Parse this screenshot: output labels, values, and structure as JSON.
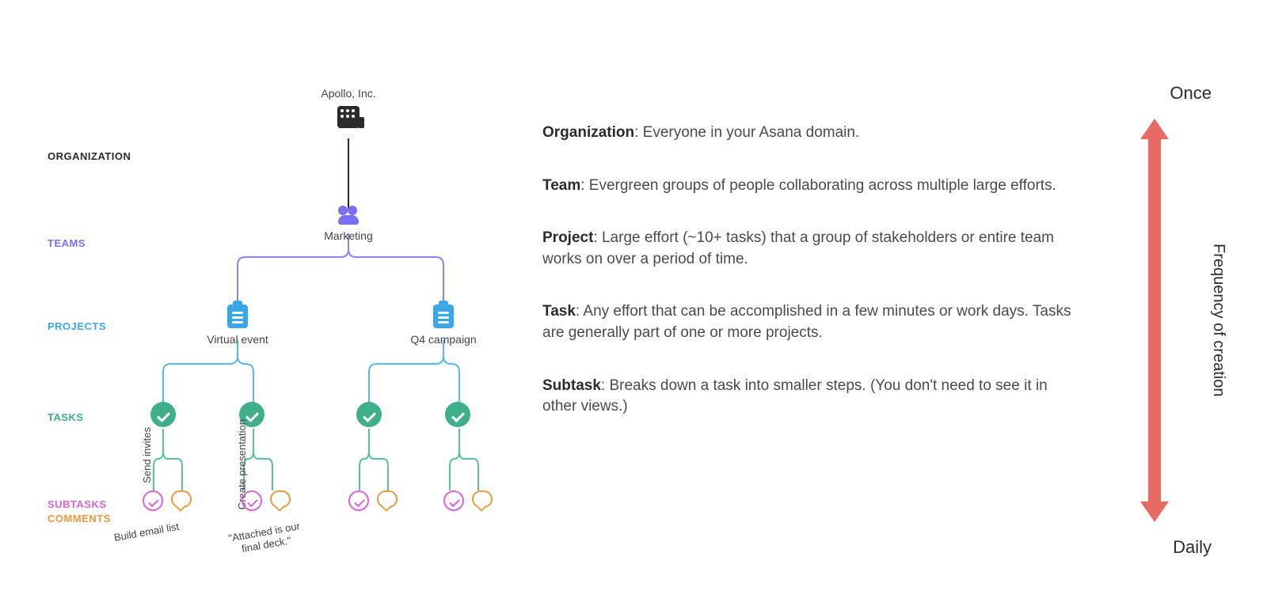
{
  "sideLabels": {
    "organization": "Organization",
    "teams": "Teams",
    "projects": "Projects",
    "tasks": "Tasks",
    "subtasks": "Subtasks",
    "comments": "Comments"
  },
  "tree": {
    "org": "Apollo, Inc.",
    "team": "Marketing",
    "projects": [
      "Virtual event",
      "Q4 campaign"
    ],
    "taskLabels": [
      "Send invites",
      "Create presentation"
    ],
    "captions": [
      "Build email list",
      "\"Attached is our final deck.\""
    ]
  },
  "descriptions": {
    "organization": {
      "title": "Organization",
      "text": ": Everyone in your Asana domain."
    },
    "team": {
      "title": "Team",
      "text": ": Evergreen groups of people collaborating across multiple large efforts."
    },
    "project": {
      "title": "Project",
      "text": ": Large effort (~10+ tasks) that a group of stakeholders or entire team works on over a period of time."
    },
    "task": {
      "title": "Task",
      "text": ": Any effort that can be accomplished in a few minutes or work days. Tasks are generally part of one or more projects."
    },
    "subtask": {
      "title": "Subtask",
      "text": ": Breaks down a task into smaller steps. (You don't need to see it in other views.)"
    }
  },
  "frequency": {
    "top": "Once",
    "bottom": "Daily",
    "side": "Frequency of creation"
  }
}
